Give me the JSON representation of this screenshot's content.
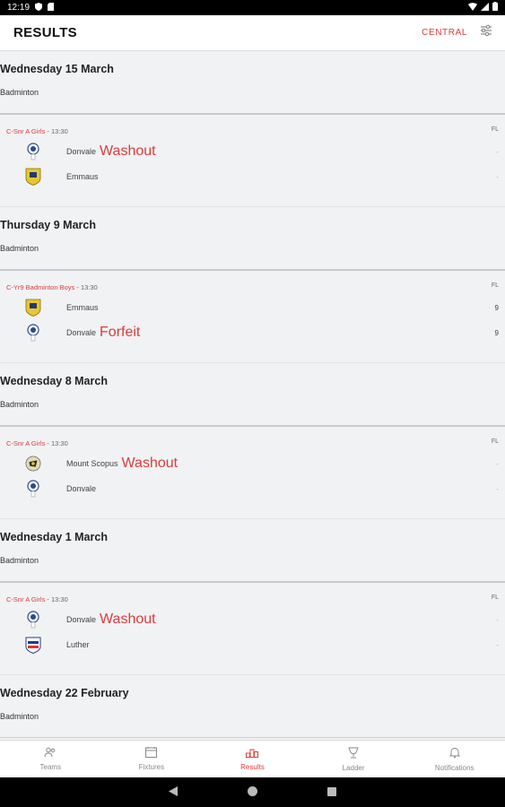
{
  "status": {
    "time": "12:19"
  },
  "header": {
    "title": "RESULTS",
    "region": "CENTRAL"
  },
  "days": [
    {
      "date": "Wednesday 15 March",
      "sport": "Badminton",
      "match": {
        "competition": "C-Snr A Girls",
        "time": " - 13:30",
        "badge": "FL",
        "teams": [
          {
            "name": "Donvale",
            "note": "Washout",
            "score": "-",
            "logo": "donvale"
          },
          {
            "name": "Emmaus",
            "note": "",
            "score": "-",
            "logo": "emmaus"
          }
        ]
      }
    },
    {
      "date": "Thursday 9 March",
      "sport": "Badminton",
      "match": {
        "competition": "C-Yr9 Badminton Boys",
        "time": " - 13:30",
        "badge": "FL",
        "teams": [
          {
            "name": "Emmaus",
            "note": "",
            "score": "9",
            "logo": "emmaus"
          },
          {
            "name": "Donvale",
            "note": "Forfeit",
            "score": "9",
            "logo": "donvale"
          }
        ]
      }
    },
    {
      "date": "Wednesday 8 March",
      "sport": "Badminton",
      "match": {
        "competition": "C-Snr A Girls",
        "time": " - 13:30",
        "badge": "FL",
        "teams": [
          {
            "name": "Mount Scopus",
            "note": "Washout",
            "score": "-",
            "logo": "scopus"
          },
          {
            "name": "Donvale",
            "note": "",
            "score": "-",
            "logo": "donvale"
          }
        ]
      }
    },
    {
      "date": "Wednesday 1 March",
      "sport": "Badminton",
      "match": {
        "competition": "C-Snr A Girls",
        "time": " - 13:30",
        "badge": "FL",
        "teams": [
          {
            "name": "Donvale",
            "note": "Washout",
            "score": "-",
            "logo": "donvale"
          },
          {
            "name": "Luther",
            "note": "",
            "score": "-",
            "logo": "luther"
          }
        ]
      }
    },
    {
      "date": "Wednesday 22 February",
      "sport": "Badminton"
    }
  ],
  "nav": [
    {
      "label": "Teams",
      "icon": "teams-icon"
    },
    {
      "label": "Fixtures",
      "icon": "fixtures-icon"
    },
    {
      "label": "Results",
      "icon": "results-icon",
      "active": true
    },
    {
      "label": "Ladder",
      "icon": "ladder-icon"
    },
    {
      "label": "Notifications",
      "icon": "notifications-icon"
    }
  ],
  "colors": {
    "accent": "#e03a3a",
    "background": "#f1f2f4"
  }
}
